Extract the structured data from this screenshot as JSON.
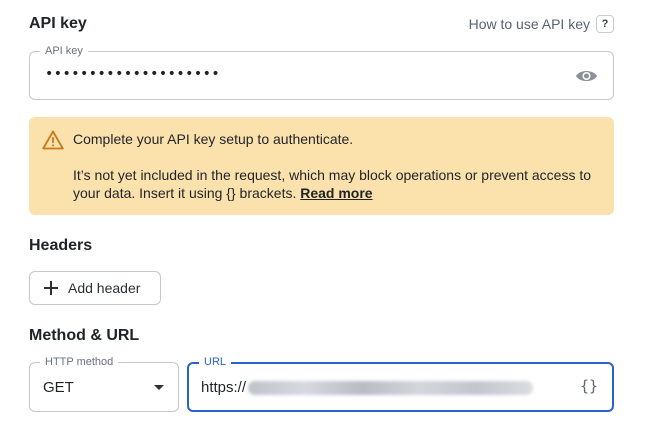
{
  "api_key": {
    "title": "API key",
    "help_link": "How to use API key",
    "help_badge": "?",
    "field_label": "API key",
    "masked_value": "••••••••••••••••••••",
    "visibility_icon": "eye-icon"
  },
  "warning": {
    "icon": "warning-triangle-icon",
    "title": "Complete your API key setup to authenticate.",
    "body": "It’s not yet included in the request, which may block operations or prevent access to your data. Insert it using {} brackets.",
    "link": "Read more",
    "bg_color": "#fbe2ac",
    "icon_color": "#c8791a"
  },
  "headers": {
    "title": "Headers",
    "add_button": "Add header"
  },
  "method_url": {
    "title": "Method & URL",
    "method_label": "HTTP method",
    "method_value": "GET",
    "url_label": "URL",
    "url_prefix": "https://",
    "variables_icon": "{}",
    "accent_color": "#2a63c7"
  }
}
